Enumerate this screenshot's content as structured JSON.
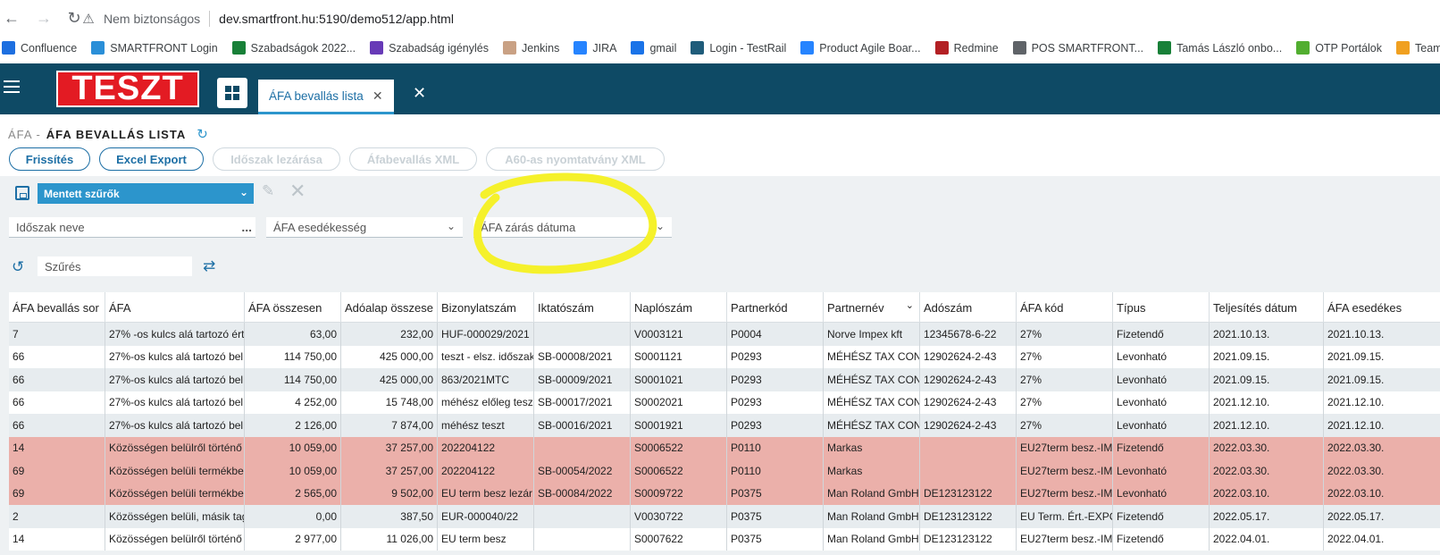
{
  "browser": {
    "security_label": "Nem biztonságos",
    "url": "dev.smartfront.hu:5190/demo512/app.html",
    "bookmarks": [
      {
        "label": "Confluence",
        "color": "#1d6fe0",
        "icon": "confluence-icon"
      },
      {
        "label": "SMARTFRONT Login",
        "color": "#2a8fd8",
        "icon": "smartfront-icon"
      },
      {
        "label": "Szabadságok 2022...",
        "color": "#188038",
        "icon": "sheets-icon"
      },
      {
        "label": "Szabadság igénylés",
        "color": "#673ab7",
        "icon": "forms-icon"
      },
      {
        "label": "Jenkins",
        "color": "#c9a184",
        "icon": "jenkins-icon"
      },
      {
        "label": "JIRA",
        "color": "#2684ff",
        "icon": "jira-icon"
      },
      {
        "label": "gmail",
        "color": "#1a73e8",
        "icon": "gmail-icon"
      },
      {
        "label": "Login - TestRail",
        "color": "#1f5c7a",
        "icon": "testrail-icon"
      },
      {
        "label": "Product Agile Boar...",
        "color": "#2684ff",
        "icon": "jira-icon"
      },
      {
        "label": "Redmine",
        "color": "#b32024",
        "icon": "redmine-icon"
      },
      {
        "label": "POS SMARTFRONT...",
        "color": "#5f6368",
        "icon": "globe-icon"
      },
      {
        "label": "Tamás László onbo...",
        "color": "#188038",
        "icon": "sheets-icon"
      },
      {
        "label": "OTP Portálok",
        "color": "#52ae30",
        "icon": "otp-icon"
      },
      {
        "label": "Teampass",
        "color": "#f0a020",
        "icon": "teampass-icon"
      }
    ]
  },
  "header": {
    "logo_text": "TESZT",
    "tab_label": "ÁFA bevallás lista"
  },
  "page": {
    "crumb": "ÁFA -",
    "title": "ÁFA BEVALLÁS LISTA"
  },
  "buttons": {
    "refresh": "Frissítés",
    "excel": "Excel Export",
    "close_period": "Időszak lezárása",
    "vat_xml": "Áfabevallás XML",
    "a60_xml": "A60-as nyomtatvány XML"
  },
  "filters": {
    "saved_filters": "Mentett szűrők",
    "period_name": "Időszak neve",
    "vat_due": "ÁFA esedékesség",
    "vat_close_date": "ÁFA zárás dátuma",
    "search_placeholder": "Szűrés"
  },
  "table": {
    "columns": [
      "ÁFA bevallás sor",
      "ÁFA",
      "ÁFA összesen",
      "Adóalap összese",
      "Bizonylatszám",
      "Iktatószám",
      "Naplószám",
      "Partnerkód",
      "Partnernév",
      "Adószám",
      "ÁFA kód",
      "Típus",
      "Teljesítés dátum",
      "ÁFA esedékes"
    ],
    "rows": [
      {
        "style": "odd",
        "cells": [
          "7",
          "27% -os kulcs alá tartozó ért",
          "63,00",
          "232,00",
          "HUF-000029/2021",
          "",
          "V0003121",
          "P0004",
          "Norve Impex kft",
          "12345678-6-22",
          "27%",
          "Fizetendő",
          "2021.10.13.",
          "2021.10.13."
        ]
      },
      {
        "style": "even",
        "cells": [
          "66",
          "27%-os kulcs alá tartozó bel",
          "114 750,00",
          "425 000,00",
          "teszt - elsz. időszak",
          "SB-00008/2021",
          "S0001121",
          "P0293",
          "MÉHÉSZ TAX CONS",
          "12902624-2-43",
          "27%",
          "Levonható",
          "2021.09.15.",
          "2021.09.15."
        ]
      },
      {
        "style": "odd",
        "cells": [
          "66",
          "27%-os kulcs alá tartozó bel",
          "114 750,00",
          "425 000,00",
          "863/2021MTC",
          "SB-00009/2021",
          "S0001021",
          "P0293",
          "MÉHÉSZ TAX CONS",
          "12902624-2-43",
          "27%",
          "Levonható",
          "2021.09.15.",
          "2021.09.15."
        ]
      },
      {
        "style": "even",
        "cells": [
          "66",
          "27%-os kulcs alá tartozó bel",
          "4 252,00",
          "15 748,00",
          "méhész előleg tesz",
          "SB-00017/2021",
          "S0002021",
          "P0293",
          "MÉHÉSZ TAX CONS",
          "12902624-2-43",
          "27%",
          "Levonható",
          "2021.12.10.",
          "2021.12.10."
        ]
      },
      {
        "style": "odd",
        "cells": [
          "66",
          "27%-os kulcs alá tartozó bel",
          "2 126,00",
          "7 874,00",
          "méhész teszt",
          "SB-00016/2021",
          "S0001921",
          "P0293",
          "MÉHÉSZ TAX CONS",
          "12902624-2-43",
          "27%",
          "Levonható",
          "2021.12.10.",
          "2021.12.10."
        ]
      },
      {
        "style": "red",
        "cells": [
          "14",
          "Közösségen belülről történő",
          "10 059,00",
          "37 257,00",
          "202204122",
          "",
          "S0006522",
          "P0110",
          "Markas",
          "",
          "EU27term besz.-IM",
          "Fizetendő",
          "2022.03.30.",
          "2022.03.30."
        ]
      },
      {
        "style": "red",
        "cells": [
          "69",
          "Közösségen belüli termékbe",
          "10 059,00",
          "37 257,00",
          "202204122",
          "SB-00054/2022",
          "S0006522",
          "P0110",
          "Markas",
          "",
          "EU27term besz.-IM",
          "Levonható",
          "2022.03.30.",
          "2022.03.30."
        ]
      },
      {
        "style": "red",
        "cells": [
          "69",
          "Közösségen belüli termékbe",
          "2 565,00",
          "9 502,00",
          "EU term besz lezár",
          "SB-00084/2022",
          "S0009722",
          "P0375",
          "Man Roland GmbH",
          "DE123123122",
          "EU27term besz.-IM",
          "Levonható",
          "2022.03.10.",
          "2022.03.10."
        ]
      },
      {
        "style": "odd",
        "cells": [
          "2",
          "Közösségen belüli, másik tag",
          "0,00",
          "387,50",
          "EUR-000040/22",
          "",
          "V0030722",
          "P0375",
          "Man Roland GmbH",
          "DE123123122",
          "EU Term. Ért.-EXPC",
          "Fizetendő",
          "2022.05.17.",
          "2022.05.17."
        ]
      },
      {
        "style": "even",
        "cells": [
          "14",
          "Közösségen belülről történő",
          "2 977,00",
          "11 026,00",
          "EU term besz",
          "",
          "S0007622",
          "P0375",
          "Man Roland GmbH",
          "DE123123122",
          "EU27term besz.-IM",
          "Fizetendő",
          "2022.04.01.",
          "2022.04.01."
        ]
      }
    ]
  }
}
